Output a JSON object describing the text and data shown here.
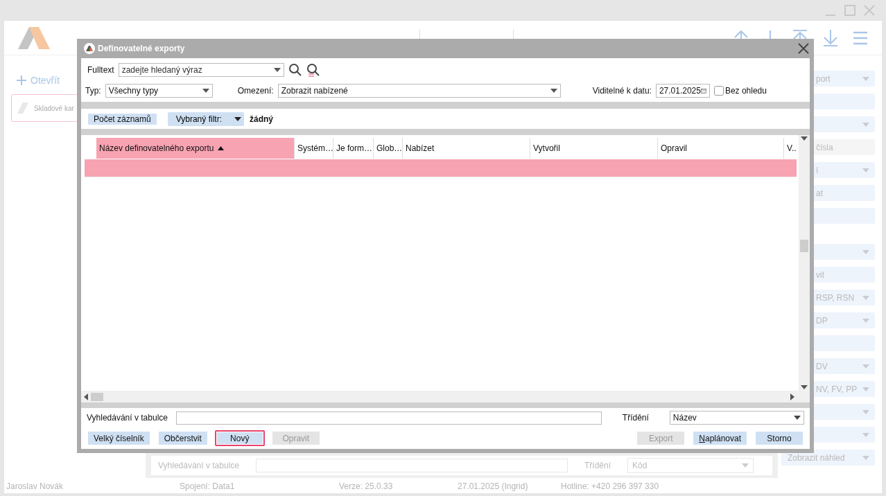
{
  "app": {
    "open_button": "Otevřít",
    "cards": [
      {
        "label": "Skladové kar",
        "selected": true
      }
    ],
    "right_panel": [
      [
        {
          "kind": "select",
          "text": "port"
        },
        {
          "kind": "input"
        },
        {
          "kind": "select"
        },
        {
          "kind": "readonly",
          "text": "čísla"
        },
        {
          "kind": "select",
          "text": "í"
        },
        {
          "kind": "input",
          "text": "at"
        },
        {
          "kind": "input"
        }
      ],
      [
        {
          "kind": "select"
        },
        {
          "kind": "input",
          "text": "vit"
        },
        {
          "kind": "select",
          "text": "RSP, RSN"
        },
        {
          "kind": "select",
          "text": "DP"
        },
        {
          "kind": "input"
        },
        {
          "kind": "select",
          "text": "DV"
        },
        {
          "kind": "select",
          "text": "NV, FV, PP"
        },
        {
          "kind": "select"
        },
        {
          "kind": "select"
        },
        {
          "kind": "select",
          "text": "Zobrazit náhled"
        }
      ]
    ],
    "bottom": {
      "search_label": "Vyhledávání v tabulce",
      "sort_label": "Třídění",
      "sort_value": "Kód"
    },
    "status_bar": [
      "Jaroslav Novák",
      "Spojení: Data1",
      "Verze: 25.0.33",
      "27.01.2025 (Ingrid)",
      "Hotline: +420 296 397 330"
    ]
  },
  "dialog": {
    "title": "Definovatelné exporty",
    "fulltext": {
      "label": "Fulltext",
      "placeholder": "zadejte hledaný výraz"
    },
    "type": {
      "label": "Typ:",
      "value": "Všechny typy"
    },
    "restriction": {
      "label": "Omezení:",
      "value": "Zobrazit nabízené"
    },
    "date": {
      "label": "Viditelné k datu:",
      "value": "27.01.2025"
    },
    "ignore": {
      "label": "Bez ohledu",
      "checked": false
    },
    "count_button": "Počet záznamů",
    "filter_button": "Vybraný filtr:",
    "filter_value": "žádný",
    "columns": [
      {
        "label": "Název definovatelného exportu",
        "sorted": true
      },
      {
        "label": "Systém…",
        "sorted": false
      },
      {
        "label": "Je form…",
        "sorted": false
      },
      {
        "label": "Glob…",
        "sorted": false
      },
      {
        "label": "Nabízet",
        "sorted": false
      },
      {
        "label": "Vytvořil",
        "sorted": false
      },
      {
        "label": "Opravil",
        "sorted": false
      },
      {
        "label": "V..",
        "sorted": false
      }
    ],
    "rows": [
      {
        "selected": true
      }
    ],
    "search_label": "Vyhledávání v tabulce",
    "sort_label": "Třídění",
    "sort_value": "Název",
    "buttons_left": [
      {
        "label": "Velký číselník",
        "disabled": false,
        "focused": false
      },
      {
        "label": "Občerstvit",
        "disabled": false,
        "focused": false
      },
      {
        "label": "Nový",
        "disabled": false,
        "focused": true
      },
      {
        "label": "Opravit",
        "disabled": true,
        "focused": false
      }
    ],
    "buttons_right": [
      {
        "label": "Export",
        "disabled": true,
        "focused": false,
        "mnemonic": false
      },
      {
        "label": "Naplánovat",
        "disabled": false,
        "focused": false,
        "mnemonic": true
      },
      {
        "label": "Storno",
        "disabled": false,
        "focused": false,
        "mnemonic": false
      }
    ]
  }
}
